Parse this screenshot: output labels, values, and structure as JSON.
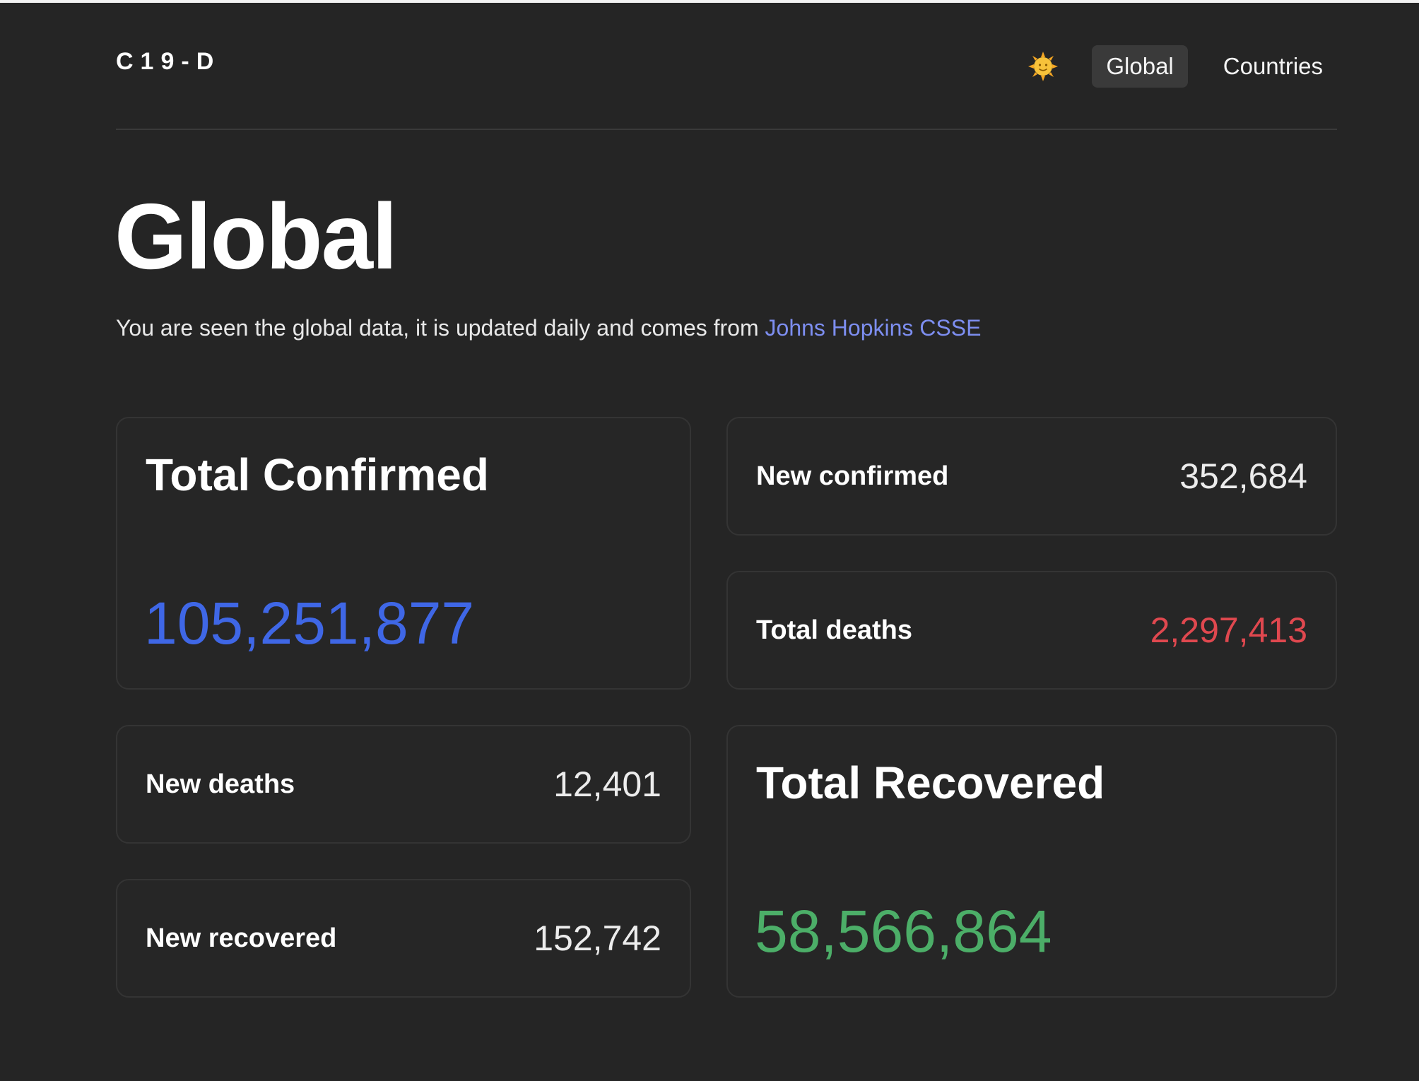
{
  "header": {
    "brand": "C19-D",
    "nav": {
      "theme_icon": "sun-face-icon",
      "items": [
        {
          "label": "Global",
          "active": true
        },
        {
          "label": "Countries",
          "active": false
        }
      ]
    }
  },
  "main": {
    "title": "Global",
    "subtitle_text": "You are seen the global data, it is updated daily and comes from ",
    "source_link": "Johns Hopkins CSSE"
  },
  "stats": {
    "total_confirmed": {
      "label": "Total Confirmed",
      "value": "105,251,877",
      "color": "#3f67e6"
    },
    "new_confirmed": {
      "label": "New confirmed",
      "value": "352,684"
    },
    "total_deaths": {
      "label": "Total deaths",
      "value": "2,297,413",
      "color": "#e0484f"
    },
    "new_deaths": {
      "label": "New deaths",
      "value": "12,401"
    },
    "total_recovered": {
      "label": "Total Recovered",
      "value": "58,566,864",
      "color": "#4cae68"
    },
    "new_recovered": {
      "label": "New recovered",
      "value": "152,742"
    }
  },
  "colors": {
    "background": "#252525",
    "link": "#7d8ef0",
    "card_border": "#343434"
  }
}
